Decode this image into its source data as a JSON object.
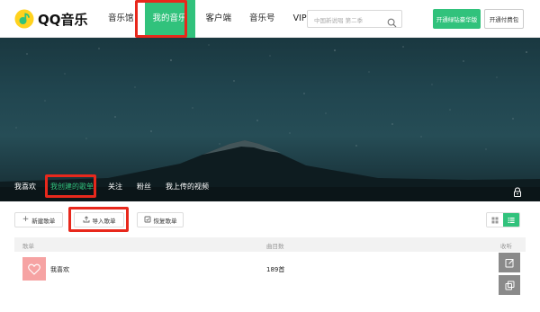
{
  "header": {
    "logo_text": "QQ音乐",
    "nav": [
      "音乐馆",
      "我的音乐",
      "客户端",
      "音乐号",
      "VIP"
    ],
    "active_nav": "我的音乐",
    "search_placeholder": "中国新说唱 第二季",
    "vip_button": "开通绿钻豪华版",
    "pay_button": "开通付费包"
  },
  "profile": {
    "tabs": [
      "我喜欢",
      "我创建的歌单",
      "关注",
      "粉丝",
      "我上传的视频"
    ],
    "active_tab": "我创建的歌单"
  },
  "toolbar": {
    "new_playlist": "新建歌单",
    "import_playlist": "导入歌单",
    "restore_playlist": "恢复歌单"
  },
  "table": {
    "headers": [
      "歌单",
      "曲目数",
      "收听"
    ],
    "rows": [
      {
        "name": "我喜欢",
        "count": "189首"
      }
    ]
  },
  "colors": {
    "accent": "#31c27c",
    "annotation": "#e8281c"
  }
}
